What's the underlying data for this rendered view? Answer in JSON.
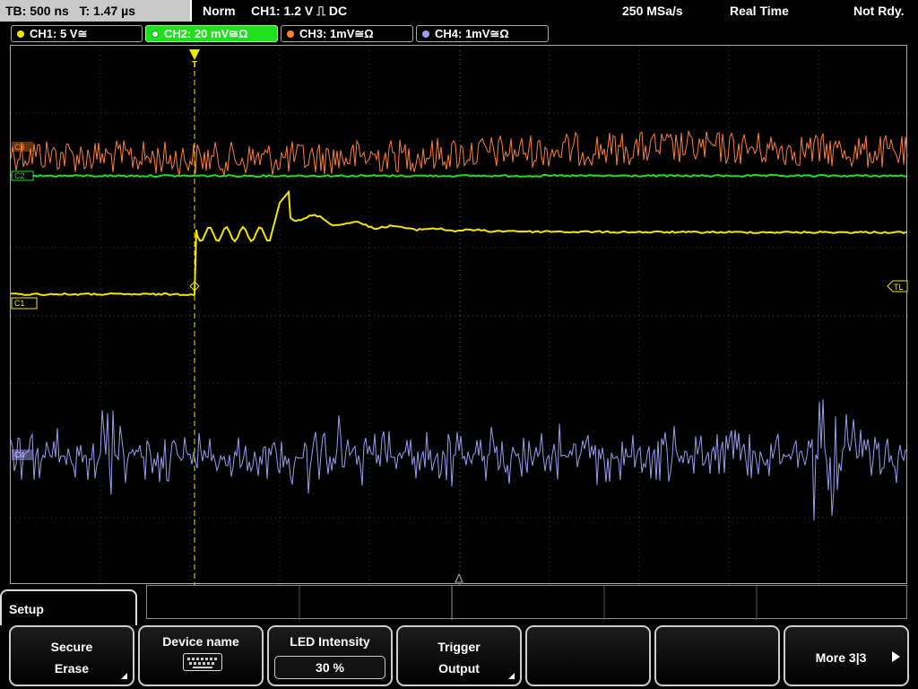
{
  "status_bar": {
    "timebase": "TB: 500 ns",
    "trigger_time": "T: 1.47 µs",
    "trigger_mode": "Norm",
    "trigger_source": "CH1: 1.2 V ⎍ DC",
    "sample_rate": "250 MSa/s",
    "acq_mode": "Real Time",
    "acq_state": "Not Rdy."
  },
  "channels": [
    {
      "label": "CH1: 5 V≅",
      "color": "#f2e600"
    },
    {
      "label": "CH2: 20 mV≅Ω",
      "color": "#1ee01e"
    },
    {
      "label": "CH3: 1mV≅Ω",
      "color": "#ff7f2a"
    },
    {
      "label": "CH4: 1mV≅Ω",
      "color": "#9b9bf0"
    }
  ],
  "markers": {
    "ch1": "C1",
    "ch2": "C2",
    "ch3": "C3",
    "ch4": "C4",
    "trigger_level": "TL"
  },
  "menu": {
    "title": "Setup",
    "softkeys": [
      {
        "line1": "Secure",
        "line2": "Erase"
      },
      {
        "line1": "Device name",
        "line2": ""
      },
      {
        "line1": "LED Intensity",
        "line2": "30 %"
      },
      {
        "line1": "Trigger",
        "line2": "Output"
      },
      {
        "line1": "",
        "line2": ""
      },
      {
        "line1": "",
        "line2": ""
      },
      {
        "line1": "More 3|3",
        "line2": ""
      }
    ]
  }
}
